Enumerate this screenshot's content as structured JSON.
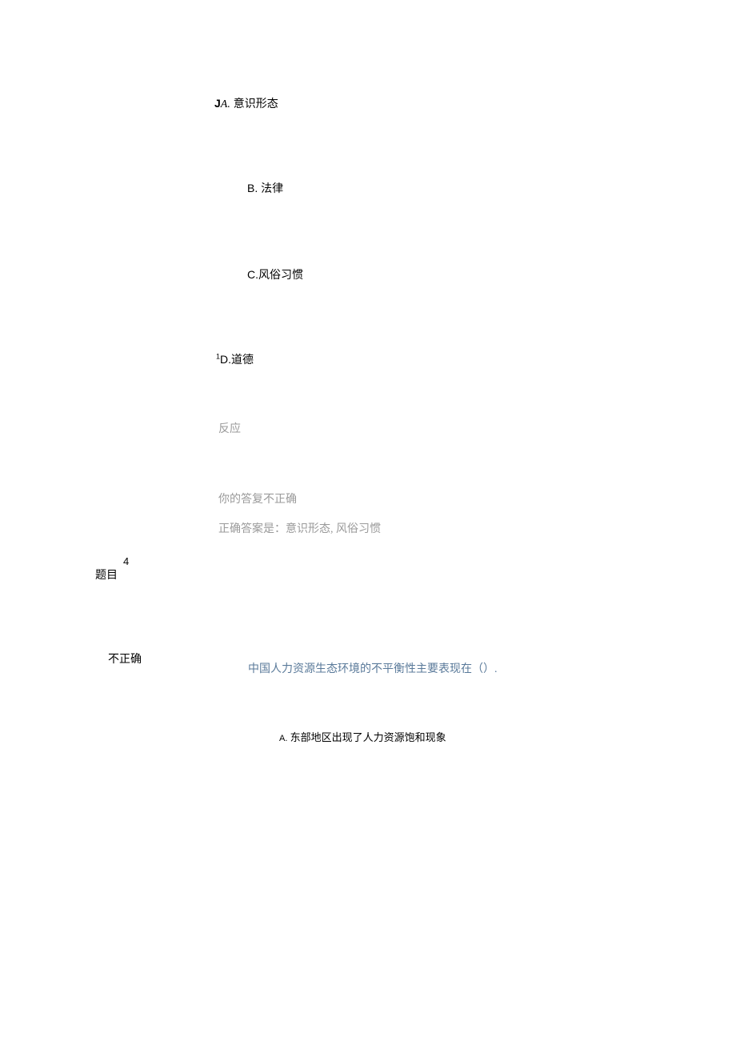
{
  "options": {
    "a": {
      "prefix": "J",
      "letter": "A.",
      "text": " 意识形态"
    },
    "b": {
      "letter": "B.",
      "text": " 法律"
    },
    "c": {
      "letter": "C.",
      "text": "风俗习惯"
    },
    "d": {
      "sup": "1",
      "letter": "D.",
      "text": "道德"
    }
  },
  "feedback": {
    "label": "反应",
    "incorrect": "你的答复不正确",
    "correct_answer": "正确答案是：意识形态, 风俗习惯"
  },
  "next_question": {
    "number": "4",
    "label": "题目",
    "status": "不正确",
    "text": "中国人力资源生态环境的不平衡性主要表现在（）.",
    "option_a_letter": "A.",
    "option_a_text": " 东部地区出现了人力资源饱和现象"
  }
}
